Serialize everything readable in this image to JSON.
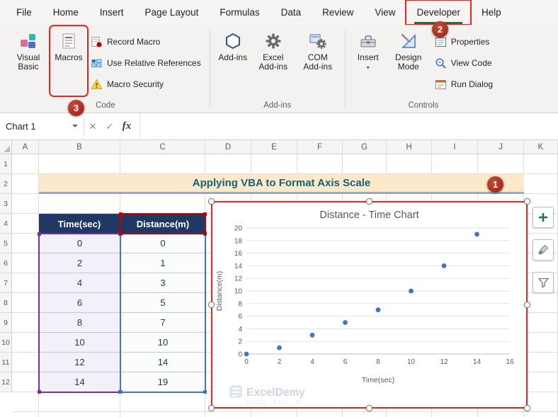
{
  "colors": {
    "anno_red": "#e8261d",
    "badge_red": "#9a2218",
    "excel_green": "#1e7145",
    "header_navy": "#1f3864",
    "title_bg": "#fce9ca",
    "title_text": "#16607a",
    "point_blue": "#4472c4",
    "range_purple": "#7030a0",
    "range_blue": "#4472c4",
    "range_red": "#c00000"
  },
  "ribbon": {
    "tabs": [
      "File",
      "Home",
      "Insert",
      "Page Layout",
      "Formulas",
      "Data",
      "Review",
      "View",
      "Developer",
      "Help"
    ],
    "active_tab": "Developer",
    "code_group": {
      "visual_basic": "Visual Basic",
      "macros": "Macros",
      "record_macro": "Record Macro",
      "use_relative_references": "Use Relative References",
      "macro_security": "Macro Security",
      "label": "Code"
    },
    "addins_group": {
      "add_ins": "Add-ins",
      "excel_add_ins": "Excel Add-ins",
      "com_add_ins": "COM Add-ins",
      "label": "Add-ins"
    },
    "controls_group": {
      "insert": "Insert",
      "design_mode": "Design Mode",
      "properties": "Properties",
      "view_code": "View Code",
      "run_dialog": "Run Dialog",
      "label": "Controls"
    }
  },
  "icons": {
    "dropdown_glyph": "▾",
    "cancel_glyph": "✕",
    "enter_glyph": "✓"
  },
  "formula_bar": {
    "name_box_value": "Chart 1",
    "fx_label": "fx",
    "formula_value": ""
  },
  "sheet": {
    "columns": [
      "A",
      "B",
      "C",
      "D",
      "E",
      "F",
      "G",
      "H",
      "I",
      "J",
      "K"
    ],
    "rows": [
      "1",
      "2",
      "3",
      "4",
      "5",
      "6",
      "7",
      "8",
      "9",
      "10",
      "11",
      "12"
    ],
    "title": "Applying VBA to Format Axis Scale",
    "table": {
      "headers": [
        "Time(sec)",
        "Distance(m)"
      ],
      "rows": [
        [
          "0",
          "0"
        ],
        [
          "2",
          "1"
        ],
        [
          "4",
          "3"
        ],
        [
          "6",
          "5"
        ],
        [
          "8",
          "7"
        ],
        [
          "10",
          "10"
        ],
        [
          "12",
          "14"
        ],
        [
          "14",
          "19"
        ]
      ]
    }
  },
  "annotations": {
    "badge_1": "1",
    "badge_2": "2",
    "badge_3": "3"
  },
  "chart_data": {
    "type": "scatter",
    "title": "Distance - Time Chart",
    "xlabel": "Time(sec)",
    "ylabel": "Distance(m)",
    "x": [
      0,
      2,
      4,
      6,
      8,
      10,
      12,
      14
    ],
    "y": [
      0,
      1,
      3,
      5,
      7,
      10,
      14,
      19
    ],
    "xlim": [
      0,
      16
    ],
    "ylim": [
      0,
      20
    ],
    "xtick_step": 2,
    "ytick_step": 2,
    "grid": true,
    "legend": "none",
    "point_color": "#4472c4",
    "watermark": "ExcelDemy",
    "watermark_sub": "EXCEL · DATA · BI"
  }
}
